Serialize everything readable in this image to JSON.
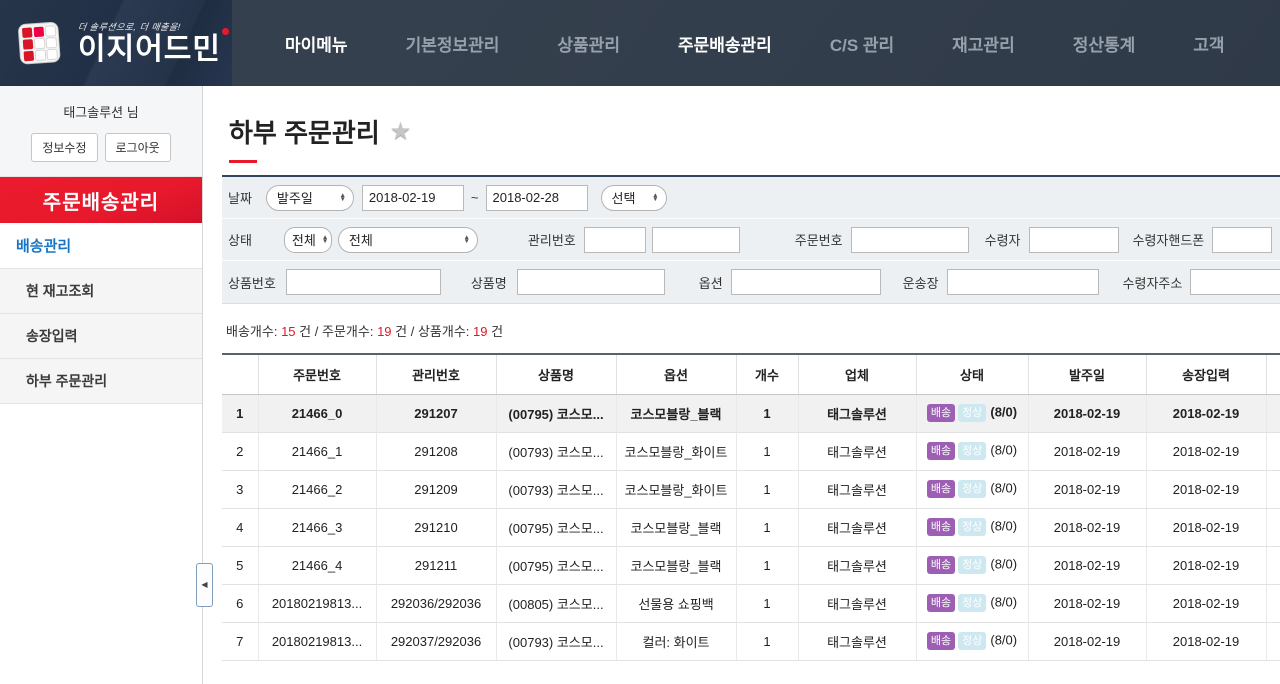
{
  "nav": {
    "brand": "이지어드민",
    "tagline": "더 솔루션으로, 더 매출을!",
    "items": [
      {
        "label": "마이메뉴",
        "active": true
      },
      {
        "label": "기본정보관리",
        "active": false
      },
      {
        "label": "상품관리",
        "active": false
      },
      {
        "label": "주문배송관리",
        "active": true
      },
      {
        "label": "C/S 관리",
        "active": false
      },
      {
        "label": "재고관리",
        "active": false
      },
      {
        "label": "정산통계",
        "active": false
      },
      {
        "label": "고객",
        "active": false
      }
    ]
  },
  "sidebar": {
    "username": "태그솔루션 님",
    "edit_button": "정보수정",
    "logout_button": "로그아웃",
    "section_title": "주문배송관리",
    "items": [
      {
        "label": "배송관리"
      },
      {
        "label": "현 재고조회"
      },
      {
        "label": "송장입력"
      },
      {
        "label": "하부 주문관리"
      }
    ]
  },
  "page": {
    "title": "하부 주문관리"
  },
  "filters": {
    "date": {
      "label": "날짜",
      "type_select": "발주일",
      "from": "2018-02-19",
      "tilde": "~",
      "to": "2018-02-28",
      "extra_select": "선택"
    },
    "status": {
      "label": "상태",
      "select1": "전체",
      "select2": "전체"
    },
    "mgmt_no_label": "관리번호",
    "order_no_label": "주문번호",
    "receiver_label": "수령자",
    "receiver_phone_label": "수령자핸드폰",
    "product_no_label": "상품번호",
    "product_name_label": "상품명",
    "option_label": "옵션",
    "invoice_label": "운송장",
    "receiver_addr_label": "수령자주소"
  },
  "summary": {
    "shipping_label": "배송개수:",
    "shipping_count": "15",
    "unit1": "건 /",
    "order_label": "주문개수:",
    "order_count": "19",
    "unit2": "건 /",
    "product_label": "상품개수:",
    "product_count": "19",
    "unit3": "건"
  },
  "table": {
    "columns": [
      "",
      "주문번호",
      "관리번호",
      "상품명",
      "옵션",
      "개수",
      "업체",
      "상태",
      "발주일",
      "송장입력",
      ""
    ],
    "badge_ship": "배송",
    "badge_normal": "정상",
    "rows": [
      {
        "no": "1",
        "order_no": "21466_0",
        "mgmt_no": "291207",
        "product": "(00795) 코스모...",
        "option": "코스모블랑_블랙",
        "qty": "1",
        "vendor": "태그솔루션",
        "status_count": "(8/0)",
        "order_date": "2018-02-19",
        "invoice_date": "2018-02-19"
      },
      {
        "no": "2",
        "order_no": "21466_1",
        "mgmt_no": "291208",
        "product": "(00793) 코스모...",
        "option": "코스모블랑_화이트",
        "qty": "1",
        "vendor": "태그솔루션",
        "status_count": "(8/0)",
        "order_date": "2018-02-19",
        "invoice_date": "2018-02-19"
      },
      {
        "no": "3",
        "order_no": "21466_2",
        "mgmt_no": "291209",
        "product": "(00793) 코스모...",
        "option": "코스모블랑_화이트",
        "qty": "1",
        "vendor": "태그솔루션",
        "status_count": "(8/0)",
        "order_date": "2018-02-19",
        "invoice_date": "2018-02-19"
      },
      {
        "no": "4",
        "order_no": "21466_3",
        "mgmt_no": "291210",
        "product": "(00795) 코스모...",
        "option": "코스모블랑_블랙",
        "qty": "1",
        "vendor": "태그솔루션",
        "status_count": "(8/0)",
        "order_date": "2018-02-19",
        "invoice_date": "2018-02-19"
      },
      {
        "no": "5",
        "order_no": "21466_4",
        "mgmt_no": "291211",
        "product": "(00795) 코스모...",
        "option": "코스모블랑_블랙",
        "qty": "1",
        "vendor": "태그솔루션",
        "status_count": "(8/0)",
        "order_date": "2018-02-19",
        "invoice_date": "2018-02-19"
      },
      {
        "no": "6",
        "order_no": "20180219813...",
        "mgmt_no": "292036/292036",
        "product": "(00805) 코스모...",
        "option": "선물용 쇼핑백",
        "qty": "1",
        "vendor": "태그솔루션",
        "status_count": "(8/0)",
        "order_date": "2018-02-19",
        "invoice_date": "2018-02-19"
      },
      {
        "no": "7",
        "order_no": "20180219813...",
        "mgmt_no": "292037/292036",
        "product": "(00793) 코스모...",
        "option": "컬러: 화이트",
        "qty": "1",
        "vendor": "태그솔루션",
        "status_count": "(8/0)",
        "order_date": "2018-02-19",
        "invoice_date": "2018-02-19"
      }
    ]
  },
  "colors": {
    "accent_red": "#e8192c",
    "badge_purple": "#9d5fb4",
    "badge_pale_blue": "#cde8f0",
    "link_blue": "#1a74c4"
  }
}
